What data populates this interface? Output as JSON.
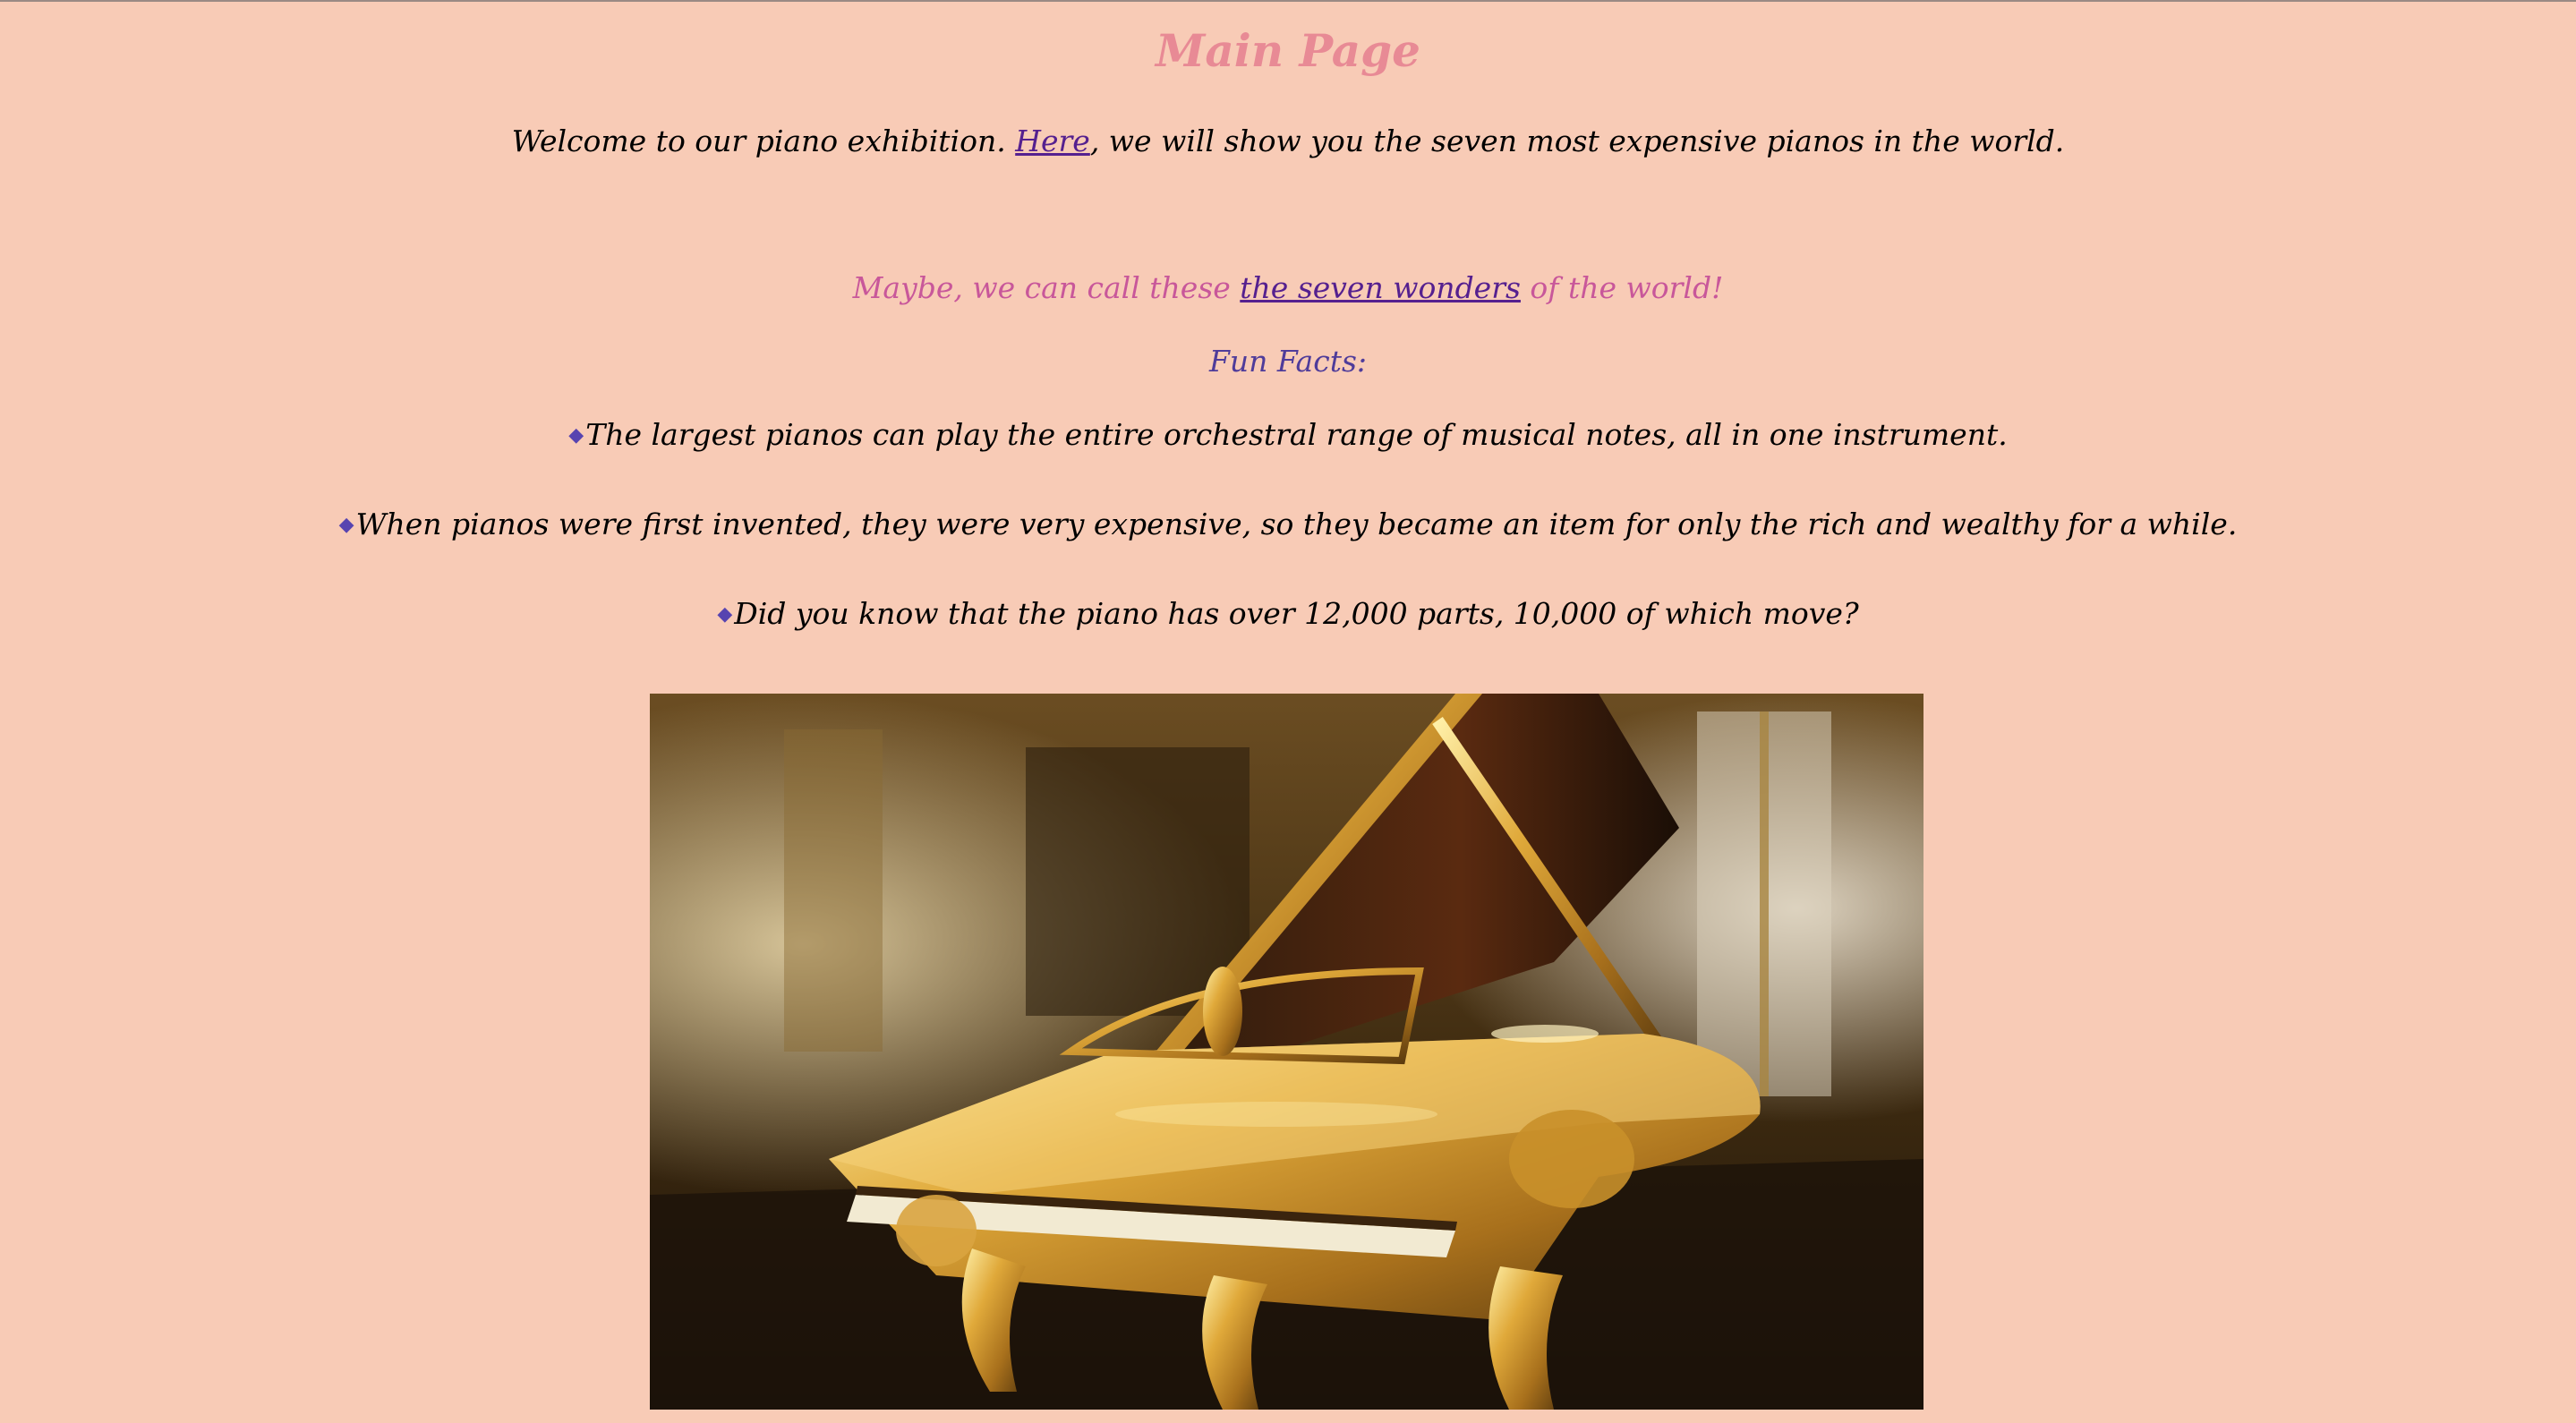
{
  "page": {
    "title": "Main Page",
    "welcome": {
      "before": "Welcome to our piano exhibition. ",
      "link": "Here",
      "after": ", we will show you the seven most expensive pianos in the world."
    },
    "wonders": {
      "before": "Maybe, we can call these ",
      "link": "the seven wonders",
      "after": " of the world!"
    },
    "fun_facts_heading": "Fun Facts:",
    "bullet_icon": "◆",
    "facts": [
      "The largest pianos can play the entire orchestral range of musical notes, all in one instrument.",
      "When pianos were first invented, they were very expensive, so they became an item for only the rich and wealthy for a while.",
      "Did you know that the piano has over 12,000 parts, 10,000 of which move?"
    ],
    "image": {
      "subject": "golden-grand-piano-photo"
    }
  },
  "colors": {
    "background": "#f8cbb6",
    "title": "#e88a95",
    "link": "#55208f",
    "wonders_text": "#c8579a",
    "fun_facts": "#4f3c9a",
    "bullet": "#5744b0"
  }
}
